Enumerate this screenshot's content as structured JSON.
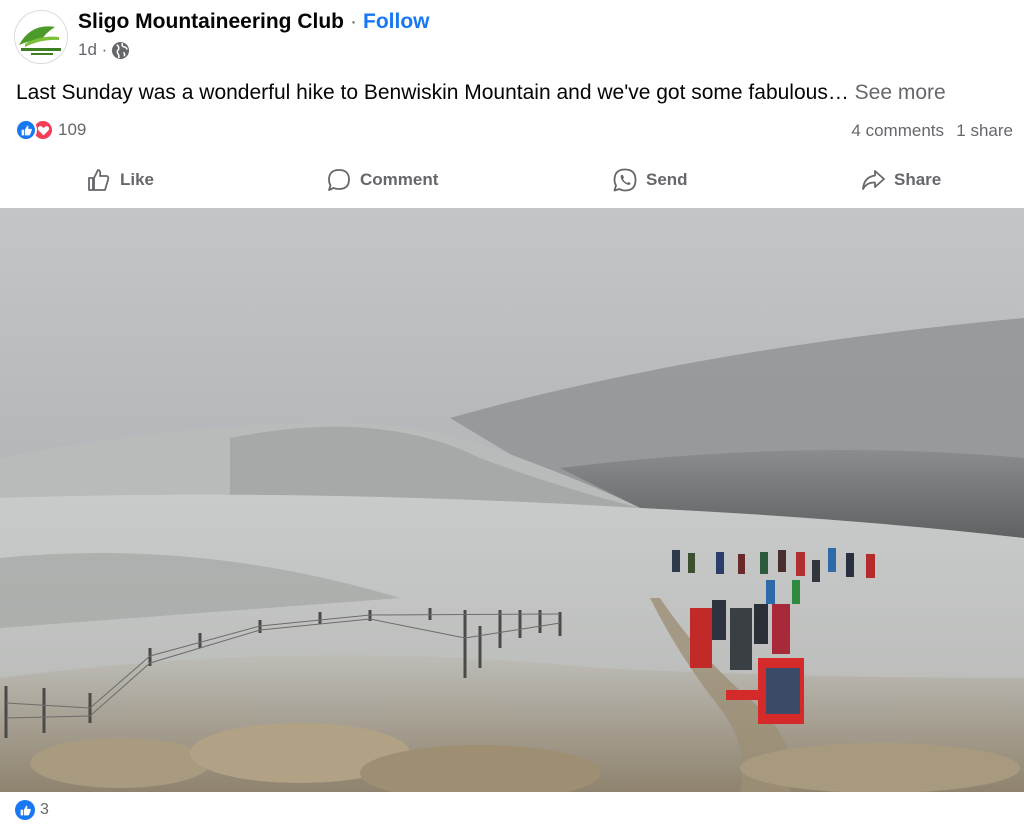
{
  "post": {
    "author": "Sligo Mountaineering Club",
    "separator": "·",
    "follow_label": "Follow",
    "time": "1d ·",
    "text": "Last Sunday was a wonderful hike to Benwiskin Mountain and we've got some fabulous…",
    "see_more": " See more",
    "reaction_count": "109",
    "comments": "4 comments",
    "shares": "1 share",
    "privacy_icon": "globe-icon",
    "reaction_icons": [
      "like-reaction-icon",
      "love-reaction-icon"
    ]
  },
  "actions": [
    {
      "label": "Like",
      "icon": "thumbs-up-icon"
    },
    {
      "label": "Comment",
      "icon": "comment-bubble-icon"
    },
    {
      "label": "Send",
      "icon": "whatsapp-icon"
    },
    {
      "label": "Share",
      "icon": "share-arrow-icon"
    }
  ],
  "footer": {
    "reaction_count": "3"
  },
  "colors": {
    "accent": "#1877f2",
    "love": "#f33e58",
    "muted": "#65676b",
    "text": "#050505"
  }
}
